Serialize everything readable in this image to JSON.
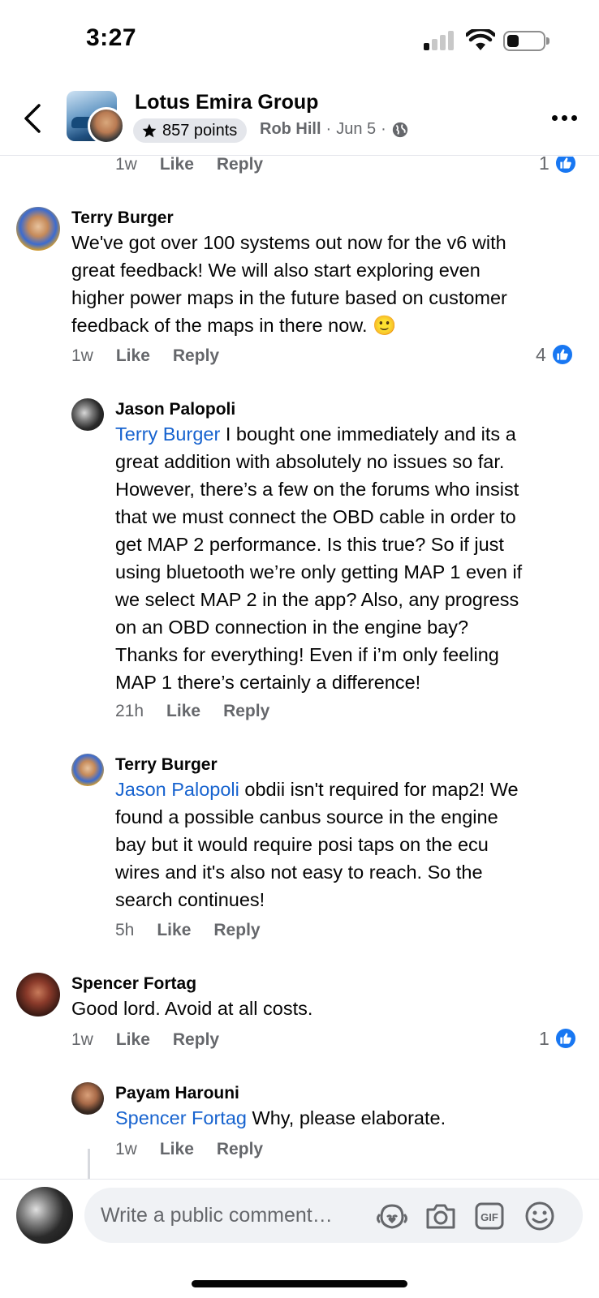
{
  "status_bar": {
    "time": "3:27"
  },
  "header": {
    "group_name": "Lotus Emira Group",
    "points": "857 points",
    "author": "Rob Hill",
    "date": "Jun 5",
    "separator": "·"
  },
  "comments": [
    {
      "id": "prev",
      "time": "1w",
      "like": "Like",
      "reply": "Reply",
      "reactions": "1"
    },
    {
      "id": "c1",
      "name": "Terry Burger",
      "lines": [
        "We've got over 100 systems out now for the v6 with",
        "great feedback! We will also start exploring even",
        "higher power maps in the future based on customer",
        "feedback of the maps in there now. 🙂"
      ],
      "time": "1w",
      "like": "Like",
      "reply": "Reply",
      "reactions": "4"
    },
    {
      "id": "c2",
      "name": "Jason Palopoli",
      "mention": "Terry Burger",
      "lines": [
        " I bought one immediately and its a",
        "great addition with absolutely no issues so far.",
        "However, there’s a few on the forums who insist",
        "that we must connect the OBD cable in order to",
        "get MAP 2 performance.  Is this true?  So if just",
        "using bluetooth we’re only getting MAP 1 even if",
        "we select MAP 2 in the app?  Also, any progress",
        "on an OBD connection in the engine bay?",
        "Thanks for everything!  Even if i’m only feeling",
        "MAP 1 there’s certainly a difference!"
      ],
      "time": "21h",
      "like": "Like",
      "reply": "Reply"
    },
    {
      "id": "c3",
      "name": "Terry Burger",
      "mention": "Jason Palopoli",
      "lines": [
        " obdii isn't required for map2! We",
        "found a possible canbus source in the engine",
        "bay but it would require posi taps on the ecu",
        "wires and it's also not easy to reach. So the",
        "search continues!"
      ],
      "time": "5h",
      "like": "Like",
      "reply": "Reply"
    },
    {
      "id": "c4",
      "name": "Spencer Fortag",
      "lines": [
        "Good lord. Avoid at all costs."
      ],
      "time": "1w",
      "like": "Like",
      "reply": "Reply",
      "reactions": "1"
    },
    {
      "id": "c5",
      "name": "Payam Harouni",
      "mention": "Spencer Fortag",
      "lines": [
        " Why, please elaborate."
      ],
      "time": "1w",
      "like": "Like",
      "reply": "Reply"
    }
  ],
  "composer": {
    "placeholder": "Write a public comment…"
  },
  "colors": {
    "link": "#1763cf",
    "like_blue": "#1877f2",
    "muted": "#65676b"
  }
}
